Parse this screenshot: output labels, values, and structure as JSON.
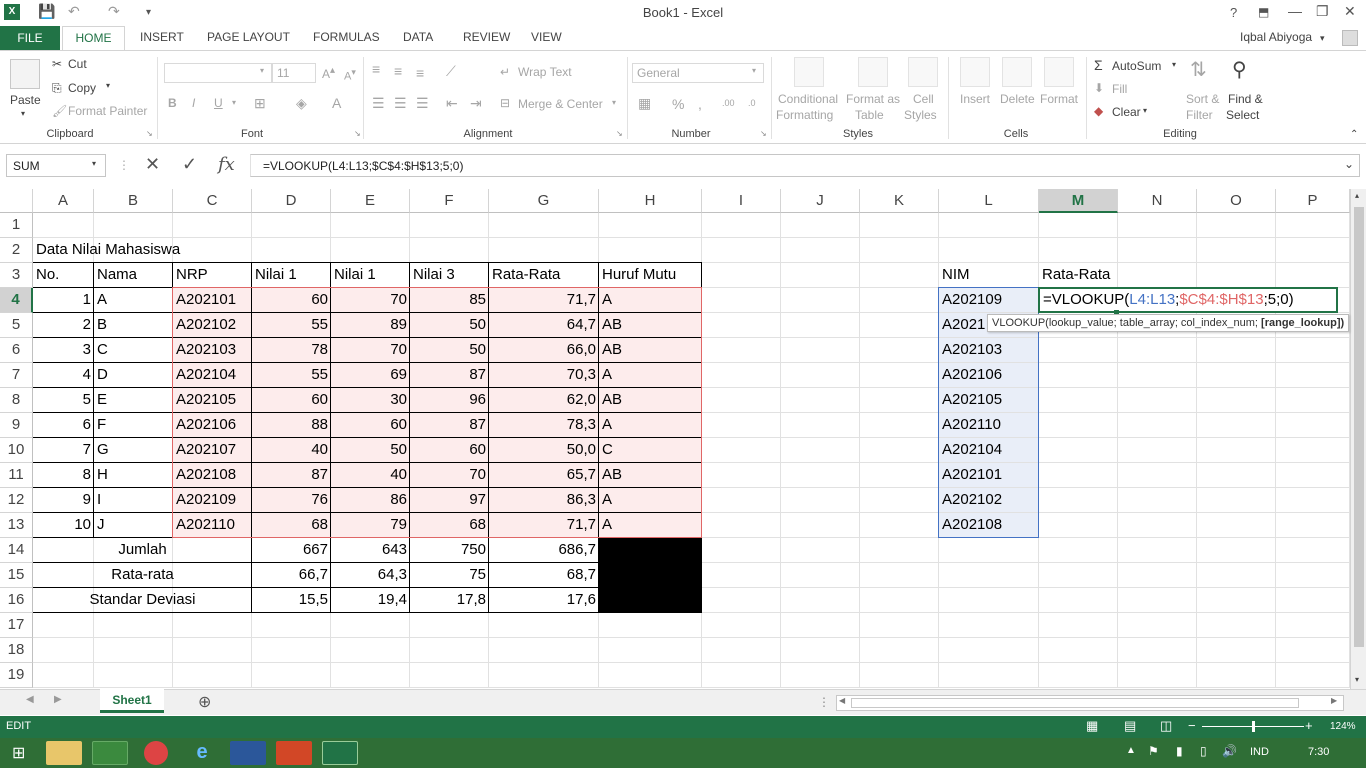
{
  "window": {
    "title": "Book1 - Excel",
    "user": "Iqbal Abiyoga",
    "help": "?"
  },
  "tabs": [
    "FILE",
    "HOME",
    "INSERT",
    "PAGE LAYOUT",
    "FORMULAS",
    "DATA",
    "REVIEW",
    "VIEW"
  ],
  "ribbon": {
    "clipboard": {
      "paste": "Paste",
      "cut": "Cut",
      "copy": "Copy",
      "format_painter": "Format Painter",
      "label": "Clipboard"
    },
    "font": {
      "size": "11",
      "bold": "B",
      "italic": "I",
      "underline": "U",
      "label": "Font"
    },
    "alignment": {
      "wrap_text": "Wrap Text",
      "merge_center": "Merge & Center",
      "label": "Alignment"
    },
    "number": {
      "format": "General",
      "label": "Number"
    },
    "styles": {
      "conditional": "Conditional",
      "conditional2": "Formatting",
      "format_as": "Format as",
      "format_as2": "Table",
      "cell": "Cell",
      "cell2": "Styles",
      "label": "Styles"
    },
    "cells": {
      "insert": "Insert",
      "delete": "Delete",
      "format": "Format",
      "label": "Cells"
    },
    "editing": {
      "autosum": "AutoSum",
      "fill": "Fill",
      "clear": "Clear",
      "sort": "Sort &",
      "sort2": "Filter",
      "find": "Find &",
      "find2": "Select",
      "label": "Editing"
    }
  },
  "formula_bar": {
    "name_box": "SUM",
    "formula": "=VLOOKUP(L4:L13;$C$4:$H$13;5;0)",
    "fx": "fx"
  },
  "columns": [
    "A",
    "B",
    "C",
    "D",
    "E",
    "F",
    "G",
    "H",
    "I",
    "J",
    "K",
    "L",
    "M",
    "N",
    "O",
    "P"
  ],
  "rows": [
    "1",
    "2",
    "3",
    "4",
    "5",
    "6",
    "7",
    "8",
    "9",
    "10",
    "11",
    "12",
    "13",
    "14",
    "15",
    "16",
    "17",
    "18",
    "19"
  ],
  "sheet": {
    "title": "Data Nilai Mahasiswa",
    "headers": [
      "No.",
      "Nama",
      "NRP",
      "Nilai 1",
      "Nilai 1",
      "Nilai 3",
      "Rata-Rata",
      "Huruf Mutu"
    ],
    "data": [
      [
        "1",
        "A",
        "A202101",
        "60",
        "70",
        "85",
        "71,7",
        "A"
      ],
      [
        "2",
        "B",
        "A202102",
        "55",
        "89",
        "50",
        "64,7",
        "AB"
      ],
      [
        "3",
        "C",
        "A202103",
        "78",
        "70",
        "50",
        "66,0",
        "AB"
      ],
      [
        "4",
        "D",
        "A202104",
        "55",
        "69",
        "87",
        "70,3",
        "A"
      ],
      [
        "5",
        "E",
        "A202105",
        "60",
        "30",
        "96",
        "62,0",
        "AB"
      ],
      [
        "6",
        "F",
        "A202106",
        "88",
        "60",
        "87",
        "78,3",
        "A"
      ],
      [
        "7",
        "G",
        "A202107",
        "40",
        "50",
        "60",
        "50,0",
        "C"
      ],
      [
        "8",
        "H",
        "A202108",
        "87",
        "40",
        "70",
        "65,7",
        "AB"
      ],
      [
        "9",
        "I",
        "A202109",
        "76",
        "86",
        "97",
        "86,3",
        "A"
      ],
      [
        "10",
        "J",
        "A202110",
        "68",
        "79",
        "68",
        "71,7",
        "A"
      ]
    ],
    "summary": [
      [
        "Jumlah",
        "667",
        "643",
        "750",
        "686,7"
      ],
      [
        "Rata-rata",
        "66,7",
        "64,3",
        "75",
        "68,7"
      ],
      [
        "Standar Deviasi",
        "15,5",
        "19,4",
        "17,8",
        "17,6"
      ]
    ],
    "lookup_headers": [
      "NIM",
      "Rata-Rata"
    ],
    "nim": [
      "A202109",
      "A2021",
      "A202103",
      "A202106",
      "A202105",
      "A202110",
      "A202104",
      "A202101",
      "A202102",
      "A202108"
    ],
    "editing_formula": {
      "prefix": "=VLOOKUP(",
      "arg1": "L4:L13",
      "sep1": ";",
      "arg2": "$C$4:$H$13",
      "rest": ";5;0)"
    },
    "tooltip": {
      "text": "VLOOKUP(lookup_value; table_array; col_index_num; ",
      "bold": "[range_lookup])"
    }
  },
  "sheet_tabs": [
    "Sheet1"
  ],
  "status": {
    "mode": "EDIT",
    "zoom": "124%"
  },
  "taskbar": {
    "lang": "IND",
    "time": "7:30"
  },
  "colors": {
    "accent": "#217346",
    "pink": "#fdecec",
    "blue_ref": "#4472c4",
    "red_ref": "#e06666"
  }
}
